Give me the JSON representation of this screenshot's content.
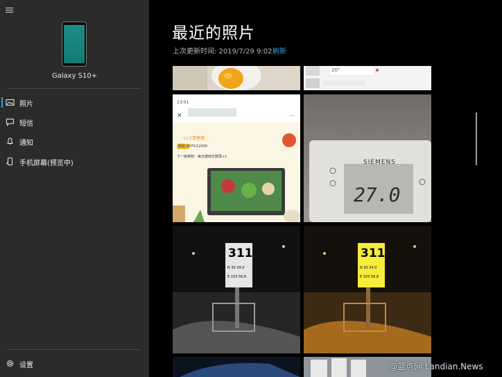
{
  "sidebar": {
    "device_name": "Galaxy S10+",
    "items": [
      {
        "label": "照片",
        "icon": "photos-icon"
      },
      {
        "label": "短信",
        "icon": "messages-icon"
      },
      {
        "label": "通知",
        "icon": "bell-icon"
      },
      {
        "label": "手机屏幕(预览中)",
        "icon": "phone-screen-icon"
      }
    ],
    "settings_label": "设置"
  },
  "main": {
    "title": "最近的照片",
    "last_updated": "上次更新时间: 2019/7/29 9:02",
    "refresh_label": "刷新"
  },
  "photos": {
    "top_right_temp": "20°",
    "screenshot_time": "13:01",
    "game_level": "Lv.5青春期",
    "game_exp": "经验 2870/12000",
    "game_hint": "下一级特权：每日游戏次数再+1",
    "thermostat_brand": "SIEMENS",
    "thermostat_reading": "27.0",
    "sign_number": "311",
    "sign_line2": "N 30 34.0",
    "sign_line3": "E 103 56.8"
  },
  "watermark": "@蓝点网 Landian.News",
  "colors": {
    "sidebar_bg": "#2b2b2b",
    "accent": "#29a2e0",
    "link": "#3b9fe0"
  }
}
